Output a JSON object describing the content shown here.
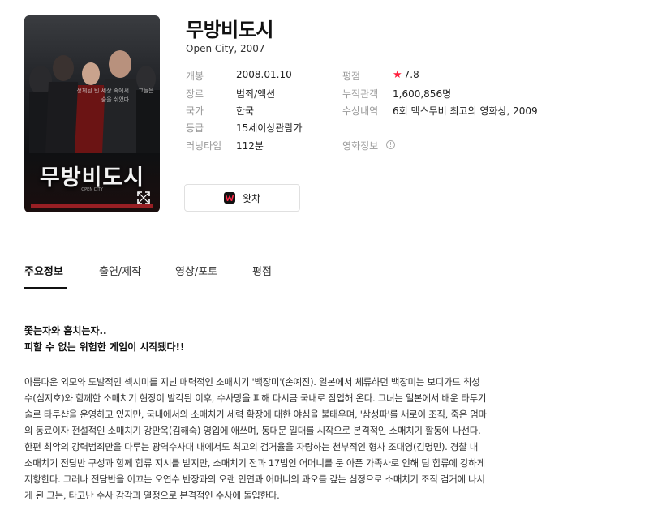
{
  "poster": {
    "title_text": "무방비도시",
    "tagline": "정체된 빈 세상 속에서 ... 그들은 숨을 쉬었다",
    "sub_text": "OPEN CITY",
    "expand_icon": "expand-icon"
  },
  "movie": {
    "title": "무방비도시",
    "subtitle": "Open City, 2007"
  },
  "info_left": [
    {
      "label": "개봉",
      "value": "2008.01.10"
    },
    {
      "label": "장르",
      "value": "범죄/액션"
    },
    {
      "label": "국가",
      "value": "한국"
    },
    {
      "label": "등급",
      "value": "15세이상관람가"
    },
    {
      "label": "러닝타임",
      "value": "112분"
    }
  ],
  "info_right": {
    "rating_label": "평점",
    "rating_value": "7.8",
    "audience_label": "누적관객",
    "audience_value": "1,600,856명",
    "awards_label": "수상내역",
    "awards_value": "6회 맥스무비 최고의 영화상, 2009",
    "info_label": "영화정보",
    "info_icon": "info-icon"
  },
  "colors": {
    "star": "#ff1f3d",
    "link": "#2d7ee8"
  },
  "watcha": {
    "label": "왓챠",
    "icon": "watcha-logo-icon"
  },
  "tabs": [
    {
      "label": "주요정보",
      "active": true
    },
    {
      "label": "출연/제작",
      "active": false
    },
    {
      "label": "영상/포토",
      "active": false
    },
    {
      "label": "평점",
      "active": false
    }
  ],
  "synopsis": {
    "headline_1": "쫓는자와 훔치는자..",
    "headline_2": "피할 수 없는 위험한 게임이 시작됐다!!",
    "lines": [
      "아름다운 외모와 도발적인 섹시미를 지닌 매력적인 소매치기 '백장미'(손예진). 일본에서 체류하던 백장미는 보디가드 최성",
      "수(심지호)와 함께한 소매치기 현장이 발각된 이후, 수사망을 피해 다시금 국내로 잠입해 온다. 그녀는 일본에서 배운 타투기",
      "술로 타투샵을 운영하고 있지만, 국내에서의 소매치기 세력 확장에 대한 야심을 불태우며, '삼성파'를 새로이 조직, 죽은 엄마",
      "의 동료이자 전설적인 소매치기 강만옥(김해숙) 영입에 애쓰며, 동대문 일대를 시작으로 본격적인 소매치기 활동에 나선다.",
      "한편 최악의 강력범죄만을 다루는 광역수사대 내에서도 최고의 검거율을 자랑하는 천부적인 형사 조대영(김명민). 경찰 내",
      "소매치기 전담반 구성과 함께 합류 지시를 받지만, 소매치기 전과 17범인 어머니를 둔 아픈 가족사로 인해 팀 합류에 강하게",
      "저항한다. 그러나 전담반을 이끄는 오연수 반장과의 오랜 인연과 어머니의 과오를 갚는 심정으로 소매치기 조직 검거에 나서",
      "게 된 그는, 타고난 수사 감각과 열정으로 본격적인 수사에 돌입한다."
    ]
  }
}
